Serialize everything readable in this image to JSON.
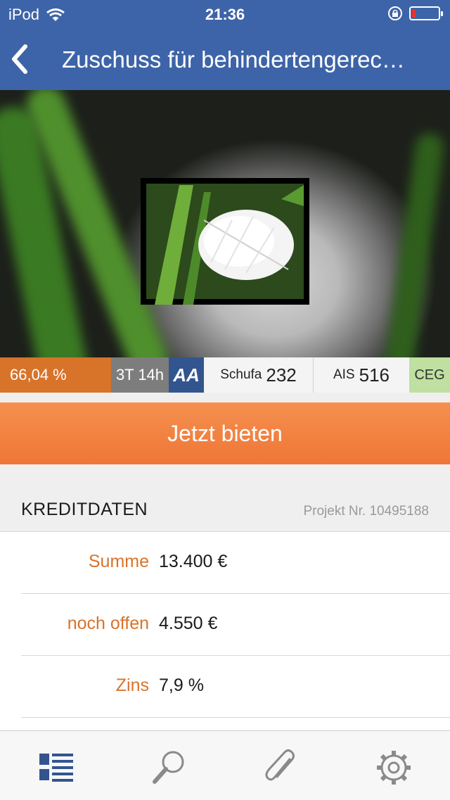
{
  "status_bar": {
    "device": "iPod",
    "time": "21:36",
    "battery_level": 0.15
  },
  "nav": {
    "title": "Zuschuss für behindertengerec…",
    "back_icon": "chevron-left-icon"
  },
  "stats": {
    "funded_percent": "66,04 %",
    "time_left": "3T 14h",
    "rating": "AA",
    "schufa_label": "Schufa",
    "schufa_value": "232",
    "ais_label": "AIS",
    "ais_value": "516",
    "ceg": "CEG"
  },
  "cta": {
    "label": "Jetzt bieten"
  },
  "section": {
    "title": "KREDITDATEN",
    "project": "Projekt Nr. 10495188"
  },
  "rows": [
    {
      "label": "Summe",
      "value": "13.400 €"
    },
    {
      "label": "noch offen",
      "value": "4.550 €"
    },
    {
      "label": "Zins",
      "value": "7,9 %"
    }
  ],
  "tabs": [
    {
      "icon": "list-icon",
      "active": true
    },
    {
      "icon": "search-icon",
      "active": false
    },
    {
      "icon": "paperclip-icon",
      "active": false
    },
    {
      "icon": "gear-icon",
      "active": false
    }
  ],
  "colors": {
    "header": "#3d64a8",
    "accent": "#ef7636",
    "label": "#d8732a",
    "rating": "#33558f",
    "ceg": "#bfe0a0"
  }
}
